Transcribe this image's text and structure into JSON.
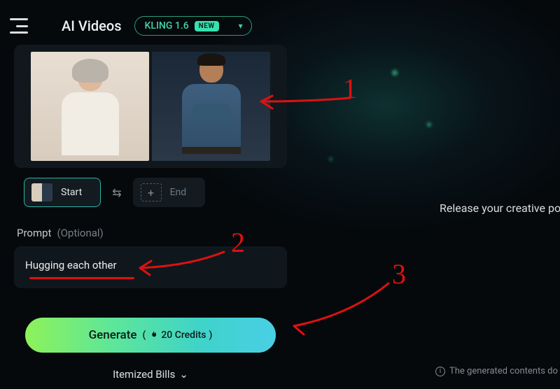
{
  "header": {
    "title": "AI Videos",
    "model_name": "KLING 1.6",
    "new_badge": "NEW"
  },
  "frames": {
    "start_label": "Start",
    "end_label": "End"
  },
  "prompt": {
    "label": "Prompt",
    "optional": "(Optional)",
    "value": "Hugging each other"
  },
  "generate": {
    "label": "Generate",
    "cost_prefix": "(",
    "cost_value": "20 Credits",
    "cost_suffix": ")"
  },
  "bills_label": "Itemized Bills",
  "right_tagline": "Release your creative pote",
  "disclaimer": "The generated contents do not represent th",
  "annotations": {
    "one": "1",
    "two": "2",
    "three": "3"
  }
}
